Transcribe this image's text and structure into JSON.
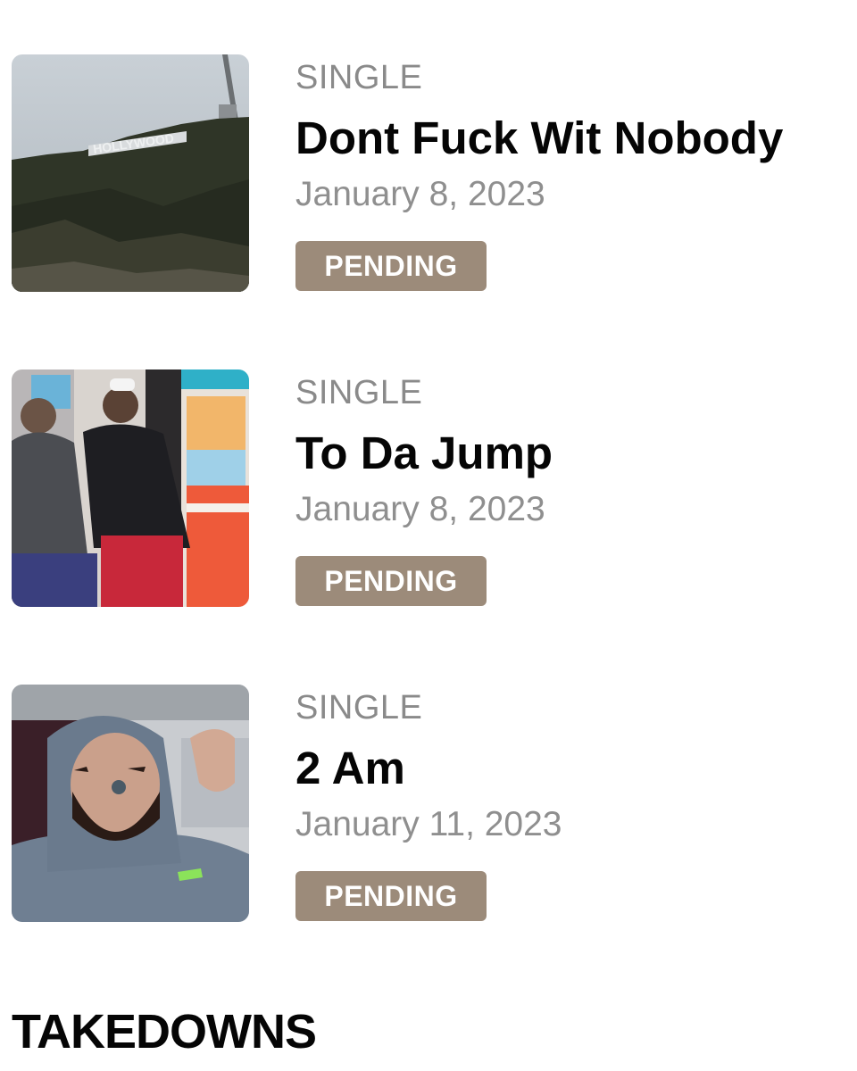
{
  "releases": [
    {
      "artwork": "hollywood-sign-hill-photo",
      "kind": "SINGLE",
      "title": "Dont Fuck Wit Nobody",
      "date": "January 8, 2023",
      "status": "PENDING",
      "artwork_sign_text": "HOLLYWOOD"
    },
    {
      "artwork": "two-people-in-store-photo",
      "kind": "SINGLE",
      "title": "To Da Jump",
      "date": "January 8, 2023",
      "status": "PENDING"
    },
    {
      "artwork": "bearded-man-in-car-selfie-photo",
      "kind": "SINGLE",
      "title": "2 Am",
      "date": "January 11, 2023",
      "status": "PENDING"
    }
  ],
  "takedowns": {
    "heading": "TAKEDOWNS"
  },
  "colors": {
    "status_badge": "#9c8b7a",
    "muted_text": "#8a8a8a",
    "title_text": "#050505"
  }
}
